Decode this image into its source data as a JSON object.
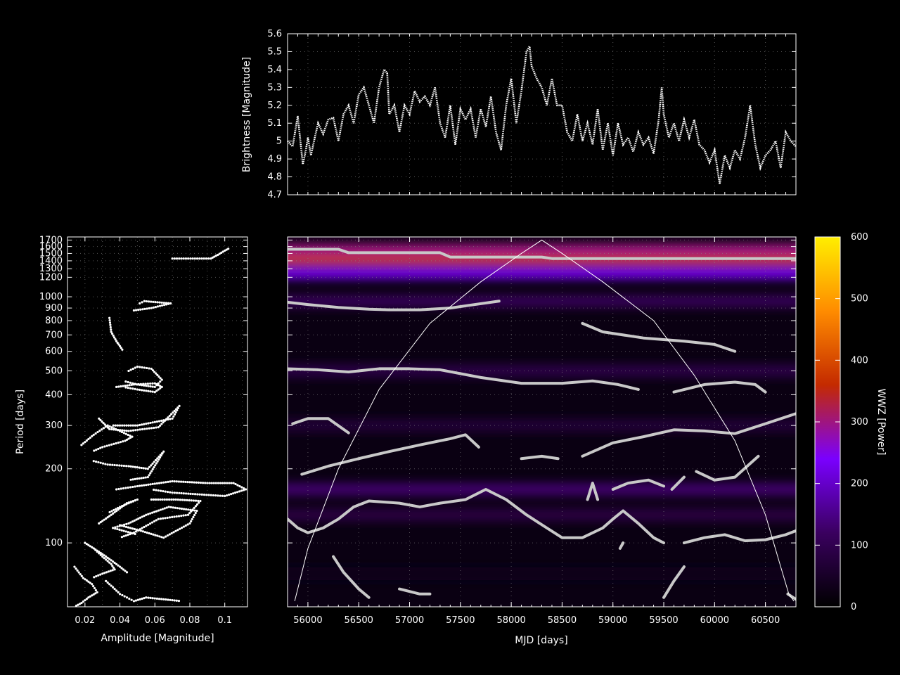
{
  "chart_data": [
    {
      "id": "brightness",
      "type": "line",
      "ylabel": "Brightness [Magnitude]",
      "xlabel": "",
      "xlim": [
        55800,
        60800
      ],
      "ylim": [
        4.7,
        5.6
      ],
      "yticks": [
        "4.7",
        "4.8",
        "4.9",
        "5",
        "5.1",
        "5.2",
        "5.3",
        "5.4",
        "5.5",
        "5.6"
      ],
      "grid": true,
      "series_color": "#ffffff",
      "x": [
        55800,
        55850,
        55900,
        55950,
        55980,
        56000,
        56030,
        56060,
        56100,
        56150,
        56200,
        56250,
        56300,
        56350,
        56400,
        56450,
        56500,
        56550,
        56600,
        56650,
        56700,
        56750,
        56780,
        56800,
        56850,
        56900,
        56950,
        57000,
        57050,
        57100,
        57150,
        57200,
        57250,
        57300,
        57350,
        57400,
        57450,
        57500,
        57550,
        57600,
        57650,
        57700,
        57750,
        57800,
        57850,
        57900,
        57950,
        58000,
        58050,
        58100,
        58150,
        58180,
        58200,
        58250,
        58300,
        58350,
        58400,
        58450,
        58500,
        58550,
        58600,
        58650,
        58700,
        58750,
        58800,
        58850,
        58900,
        58950,
        59000,
        59050,
        59100,
        59150,
        59200,
        59250,
        59300,
        59350,
        59400,
        59450,
        59480,
        59500,
        59550,
        59600,
        59650,
        59700,
        59750,
        59800,
        59850,
        59900,
        59950,
        60000,
        60050,
        60100,
        60150,
        60200,
        60250,
        60300,
        60350,
        60400,
        60450,
        60500,
        60550,
        60600,
        60650,
        60700,
        60750,
        60800
      ],
      "y": [
        5.0,
        4.97,
        5.14,
        4.87,
        4.95,
        5.02,
        4.92,
        5.0,
        5.1,
        5.04,
        5.12,
        5.13,
        5.0,
        5.15,
        5.2,
        5.1,
        5.26,
        5.3,
        5.2,
        5.1,
        5.3,
        5.4,
        5.38,
        5.15,
        5.2,
        5.05,
        5.2,
        5.15,
        5.28,
        5.22,
        5.25,
        5.2,
        5.3,
        5.1,
        5.02,
        5.2,
        4.98,
        5.18,
        5.12,
        5.18,
        5.02,
        5.18,
        5.08,
        5.25,
        5.05,
        4.95,
        5.2,
        5.35,
        5.1,
        5.28,
        5.5,
        5.53,
        5.42,
        5.35,
        5.3,
        5.2,
        5.35,
        5.2,
        5.2,
        5.05,
        5.0,
        5.15,
        5.0,
        5.1,
        4.98,
        5.18,
        4.95,
        5.1,
        4.92,
        5.1,
        4.98,
        5.02,
        4.94,
        5.05,
        4.98,
        5.02,
        4.93,
        5.12,
        5.3,
        5.15,
        5.02,
        5.1,
        5.0,
        5.12,
        5.02,
        5.12,
        4.98,
        4.95,
        4.88,
        4.95,
        4.76,
        4.92,
        4.85,
        4.95,
        4.9,
        5.02,
        5.2,
        4.98,
        4.85,
        4.92,
        4.95,
        5.0,
        4.85,
        5.05,
        5.0,
        4.97
      ]
    },
    {
      "id": "wwz",
      "type": "heatmap",
      "xlabel": "MJD [days]",
      "ylabel": "",
      "xlim": [
        55800,
        60800
      ],
      "ylim": [
        55,
        1750
      ],
      "yscale": "log",
      "xticks": [
        "56000",
        "56500",
        "57000",
        "57500",
        "58000",
        "58500",
        "59000",
        "59500",
        "60000",
        "60500"
      ],
      "grid": true,
      "colormap": [
        "#000000",
        "#3a005f",
        "#7a00ff",
        "#c42a00",
        "#ff8c00",
        "#ffee00"
      ],
      "ridge_color": "#c8c8c8",
      "coi_color": "#ffffff",
      "power_bands": [
        {
          "period": 1430,
          "power": 380
        },
        {
          "period": 1550,
          "power": 300
        },
        {
          "period": 1250,
          "power": 220
        },
        {
          "period": 960,
          "power": 110
        },
        {
          "period": 500,
          "power": 90
        },
        {
          "period": 300,
          "power": 70
        },
        {
          "period": 165,
          "power": 130
        },
        {
          "period": 130,
          "power": 85
        },
        {
          "period": 75,
          "power": 35
        }
      ],
      "ridges": [
        {
          "x": [
            55800,
            56300,
            56400,
            57300,
            57400,
            58300,
            58400,
            60800
          ],
          "y": [
            1560,
            1560,
            1510,
            1510,
            1450,
            1450,
            1430,
            1430
          ]
        },
        {
          "x": [
            55800,
            56000,
            56300,
            56600,
            56800,
            57100,
            57400,
            57600,
            57880
          ],
          "y": [
            950,
            930,
            905,
            890,
            885,
            885,
            900,
            925,
            960
          ]
        },
        {
          "x": [
            58700,
            58900,
            59300,
            59700,
            60000,
            60200
          ],
          "y": [
            780,
            720,
            680,
            660,
            640,
            600
          ]
        },
        {
          "x": [
            55800,
            56100,
            56400,
            56700,
            57000,
            57300,
            57700,
            58100,
            58500,
            58800,
            59050,
            59250
          ],
          "y": [
            510,
            505,
            495,
            510,
            510,
            505,
            470,
            445,
            445,
            455,
            440,
            420
          ]
        },
        {
          "x": [
            59600,
            59900,
            60200,
            60400,
            60500
          ],
          "y": [
            410,
            440,
            450,
            440,
            410
          ]
        },
        {
          "x": [
            55850,
            56000,
            56200,
            56400
          ],
          "y": [
            305,
            320,
            320,
            280
          ]
        },
        {
          "x": [
            55940,
            56200,
            56500,
            56800,
            57100,
            57400,
            57550,
            57680
          ],
          "y": [
            190,
            205,
            220,
            235,
            250,
            265,
            275,
            245
          ]
        },
        {
          "x": [
            58700,
            59000,
            59300,
            59600,
            59900,
            60200,
            60500,
            60800
          ],
          "y": [
            225,
            255,
            270,
            288,
            285,
            278,
            305,
            335
          ]
        },
        {
          "x": [
            58100,
            58300,
            58460
          ],
          "y": [
            220,
            225,
            220
          ]
        },
        {
          "x": [
            59000,
            59150,
            59350,
            59500
          ],
          "y": [
            165,
            175,
            180,
            170
          ]
        },
        {
          "x": [
            59580,
            59700
          ],
          "y": [
            165,
            185
          ]
        },
        {
          "x": [
            59820,
            60000,
            60200,
            60430
          ],
          "y": [
            195,
            180,
            185,
            225
          ]
        },
        {
          "x": [
            55800,
            55900,
            56000,
            56150,
            56300,
            56450,
            56600,
            56900,
            57100,
            57300,
            57550,
            57750,
            57950,
            58150,
            58350,
            58500,
            58700,
            58900,
            59000,
            59100,
            59250,
            59400,
            59500
          ],
          "y": [
            125,
            115,
            110,
            115,
            125,
            140,
            148,
            145,
            140,
            145,
            150,
            165,
            150,
            130,
            115,
            105,
            105,
            115,
            125,
            135,
            120,
            105,
            100
          ]
        },
        {
          "x": [
            59700,
            59900,
            60100,
            60300,
            60500,
            60700,
            60800
          ],
          "y": [
            100,
            105,
            108,
            102,
            103,
            108,
            112
          ]
        },
        {
          "x": [
            58750,
            58800,
            58850
          ],
          "y": [
            150,
            175,
            150
          ]
        },
        {
          "x": [
            59070,
            59100
          ],
          "y": [
            95,
            100
          ]
        },
        {
          "x": [
            56250,
            56350,
            56500,
            56600
          ],
          "y": [
            88,
            76,
            65,
            60
          ]
        },
        {
          "x": [
            56900,
            57100,
            57200
          ],
          "y": [
            65,
            62,
            62
          ]
        },
        {
          "x": [
            59500,
            59600,
            59700
          ],
          "y": [
            60,
            70,
            80
          ]
        },
        {
          "x": [
            60720,
            60800
          ],
          "y": [
            62,
            59
          ]
        }
      ],
      "coi": {
        "x": [
          55870,
          56000,
          56300,
          56700,
          57200,
          57700,
          58100,
          58300,
          58500,
          58900,
          59400,
          59800,
          60200,
          60500,
          60650,
          60730,
          60780
        ],
        "y": [
          58,
          95,
          200,
          420,
          780,
          1150,
          1500,
          1700,
          1500,
          1150,
          800,
          480,
          260,
          130,
          80,
          62,
          58
        ]
      }
    },
    {
      "id": "colorbar",
      "type": "colorbar",
      "ylabel": "WWZ [Power]",
      "ylim": [
        0,
        600
      ],
      "yticks": [
        "0",
        "100",
        "200",
        "300",
        "400",
        "500",
        "600"
      ],
      "colormap": [
        "#000000",
        "#3a005f",
        "#7a00ff",
        "#c42a00",
        "#ff8c00",
        "#ffee00"
      ]
    },
    {
      "id": "amplitude",
      "type": "scatter",
      "xlabel": "Amplitude [Magnitude]",
      "ylabel": "Period [days]",
      "xlim": [
        0.01,
        0.113
      ],
      "ylim": [
        55,
        1750
      ],
      "yscale": "log",
      "xticks": [
        "0.02",
        "0.04",
        "0.06",
        "0.08",
        "0.1"
      ],
      "yticks": [
        "100",
        "200",
        "300",
        "400",
        "500",
        "600",
        "700",
        "800",
        "900",
        "1000",
        "1200",
        "1300",
        "1400",
        "1500",
        "1600",
        "1700"
      ],
      "grid": true,
      "point_color": "#ffffff",
      "curves": [
        {
          "x": [
            0.07,
            0.092,
            0.096,
            0.1,
            0.103
          ],
          "y": [
            1430,
            1430,
            1480,
            1540,
            1580
          ]
        },
        {
          "x": [
            0.048,
            0.058,
            0.069,
            0.054,
            0.05
          ],
          "y": [
            880,
            900,
            940,
            960,
            930
          ]
        },
        {
          "x": [
            0.034,
            0.035,
            0.038,
            0.04,
            0.042
          ],
          "y": [
            820,
            720,
            660,
            630,
            600
          ]
        },
        {
          "x": [
            0.045,
            0.05,
            0.058,
            0.064,
            0.06,
            0.05,
            0.042
          ],
          "y": [
            500,
            520,
            510,
            460,
            430,
            440,
            455
          ]
        },
        {
          "x": [
            0.038,
            0.048,
            0.06,
            0.064,
            0.06,
            0.05,
            0.042
          ],
          "y": [
            430,
            440,
            445,
            430,
            410,
            420,
            430
          ]
        },
        {
          "x": [
            0.028,
            0.034,
            0.045,
            0.062,
            0.074,
            0.07,
            0.05,
            0.035
          ],
          "y": [
            320,
            290,
            285,
            295,
            360,
            320,
            300,
            300
          ]
        },
        {
          "x": [
            0.018,
            0.025,
            0.033,
            0.047,
            0.043,
            0.03,
            0.024
          ],
          "y": [
            250,
            275,
            300,
            270,
            260,
            245,
            235
          ]
        },
        {
          "x": [
            0.025,
            0.033,
            0.045,
            0.056,
            0.065,
            0.056,
            0.045
          ],
          "y": [
            215,
            208,
            205,
            200,
            235,
            185,
            180
          ]
        },
        {
          "x": [
            0.038,
            0.05,
            0.07,
            0.09,
            0.105,
            0.112,
            0.1,
            0.07,
            0.058
          ],
          "y": [
            165,
            170,
            178,
            175,
            175,
            165,
            155,
            160,
            165
          ]
        },
        {
          "x": [
            0.058,
            0.072,
            0.086,
            0.079,
            0.062,
            0.048,
            0.04
          ],
          "y": [
            150,
            150,
            148,
            130,
            125,
            110,
            105
          ]
        },
        {
          "x": [
            0.04,
            0.052,
            0.065,
            0.08,
            0.084,
            0.068,
            0.055,
            0.045,
            0.036,
            0.046,
            0.05
          ],
          "y": [
            118,
            112,
            105,
            120,
            135,
            140,
            130,
            120,
            115,
            110,
            108
          ]
        },
        {
          "x": [
            0.028,
            0.035,
            0.044,
            0.05,
            0.04,
            0.033
          ],
          "y": [
            120,
            130,
            145,
            150,
            140,
            132
          ]
        },
        {
          "x": [
            0.025,
            0.03,
            0.035,
            0.037,
            0.03,
            0.024
          ],
          "y": [
            95,
            88,
            82,
            78,
            75,
            72
          ]
        },
        {
          "x": [
            0.014,
            0.019,
            0.024,
            0.027,
            0.022,
            0.018,
            0.014
          ],
          "y": [
            80,
            72,
            68,
            63,
            60,
            57,
            55
          ]
        },
        {
          "x": [
            0.032,
            0.036,
            0.04,
            0.044,
            0.048,
            0.055,
            0.065,
            0.075
          ],
          "y": [
            70,
            66,
            62,
            60,
            58,
            60,
            59,
            58
          ]
        },
        {
          "x": [
            0.02,
            0.025,
            0.03,
            0.035,
            0.04,
            0.045
          ],
          "y": [
            100,
            95,
            90,
            85,
            80,
            75
          ]
        }
      ]
    }
  ]
}
